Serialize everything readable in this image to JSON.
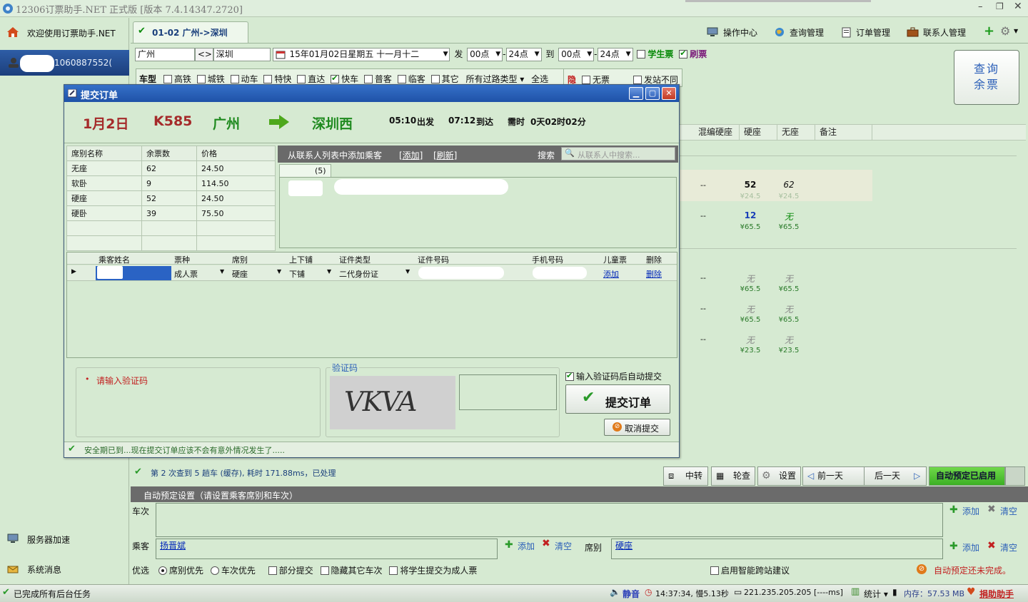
{
  "app": {
    "title": "12306订票助手.NET   正式版 [版本 7.4.14347.2720]",
    "colors": {
      "accent": "#2b5fb8",
      "green": "#0a8a0a",
      "red": "#c22020",
      "panel": "#d6ead2"
    }
  },
  "sidebar": {
    "welcome": "欢迎使用订票助手.NET",
    "account": "1060887552(",
    "items": [
      {
        "label": "服务器加速",
        "icon": "monitor-icon"
      },
      {
        "label": "系统消息",
        "icon": "message-icon"
      }
    ]
  },
  "topbar": {
    "tab_label": "01-02 广州->深圳",
    "menu": [
      {
        "label": "操作中心",
        "icon": "monitor-icon"
      },
      {
        "label": "查询管理",
        "icon": "globe-icon"
      },
      {
        "label": "订单管理",
        "icon": "document-icon"
      },
      {
        "label": "联系人管理",
        "icon": "briefcase-icon"
      }
    ]
  },
  "search": {
    "from": "广州",
    "swap": "<>",
    "to": "深圳",
    "date": "15年01月02日星期五 十一月十二",
    "depart_label": "发",
    "depart_from": "00点",
    "dash": "-",
    "depart_to": "24点",
    "arrive_label": "到",
    "arrive_from": "00点",
    "arrive_to": "24点",
    "student_label": "学生票",
    "brush_label": "刷票",
    "type_label": "车型",
    "types": [
      {
        "label": "高铁",
        "checked": false
      },
      {
        "label": "城铁",
        "checked": false
      },
      {
        "label": "动车",
        "checked": false
      },
      {
        "label": "特快",
        "checked": false
      },
      {
        "label": "直达",
        "checked": false
      },
      {
        "label": "快车",
        "checked": true
      },
      {
        "label": "普客",
        "checked": false
      },
      {
        "label": "临客",
        "checked": false
      },
      {
        "label": "其它",
        "checked": false
      }
    ],
    "passing_label": "所有过路类型",
    "select_all": "全选",
    "hide_label": "隐",
    "no_ticket": "无票",
    "diff_station": "发站不同",
    "query_button": "查询\n余票"
  },
  "results": {
    "headers": [
      "混编硬座",
      "硬座",
      "无座",
      "备注"
    ],
    "rows": [
      {
        "mixed": "--",
        "hard": "52",
        "hard_price": "¥24.5",
        "none": "62",
        "none_price": "¥24.5"
      },
      {
        "mixed": "--",
        "hard": "12",
        "hard_price": "¥65.5",
        "none": "无",
        "none_price": "¥65.5"
      },
      {
        "mixed": "--",
        "hard": "无",
        "hard_price": "¥65.5",
        "none": "无",
        "none_price": "¥65.5"
      },
      {
        "mixed": "--",
        "hard": "无",
        "hard_price": "¥65.5",
        "none": "无",
        "none_price": "¥65.5"
      },
      {
        "mixed": "--",
        "hard": "无",
        "hard_price": "¥23.5",
        "none": "无",
        "none_price": "¥23.5"
      }
    ]
  },
  "dialog": {
    "title": "提交订单",
    "date": "1月2日",
    "train": "K585",
    "from": "广州",
    "to": "深圳西",
    "depart_time": "05:10",
    "depart_label": "出发",
    "arrive_time": "07:12",
    "arrive_label": "到达",
    "duration_label": "需时",
    "duration": "0天02时02分",
    "seat_headers": [
      "席别名称",
      "余票数",
      "价格"
    ],
    "seats": [
      {
        "name": "无座",
        "count": "62",
        "price": "24.50"
      },
      {
        "name": "软卧",
        "count": "9",
        "price": "114.50"
      },
      {
        "name": "硬座",
        "count": "52",
        "price": "24.50"
      },
      {
        "name": "硬卧",
        "count": "39",
        "price": "75.50"
      }
    ],
    "contacts_title": "从联系人列表中添加乘客",
    "contacts_add": "[添加]",
    "contacts_refresh": "[刷新]",
    "search_label": "搜索",
    "search_placeholder": "从联系人中搜索...",
    "contacts_tab_count": "(5)",
    "passenger_headers": [
      "乘客姓名",
      "票种",
      "席别",
      "上下铺",
      "证件类型",
      "证件号码",
      "手机号码",
      "儿童票",
      "删除"
    ],
    "passenger": {
      "ticket_type": "成人票",
      "seat": "硬座",
      "berth": "下铺",
      "id_type": "二代身份证",
      "child": "添加",
      "delete": "删除"
    },
    "message": "请输入验证码",
    "captcha_label": "验证码",
    "captcha_text": "VKVA",
    "auto_submit_label": "输入验证码后自动提交",
    "submit_label": "提交订单",
    "cancel_label": "取消提交",
    "status": "安全期已到...现在提交订单应该不会有意外情况发生了....."
  },
  "toolbar": {
    "status": "第 2 次查到 5 趟车 (缓存), 耗时 171.88ms，已处理",
    "transfer": "中转",
    "poll": "轮查",
    "settings": "设置",
    "prev_day": "前一天",
    "next_day": "后一天",
    "auto_enabled": "自动预定已启用"
  },
  "auto": {
    "header": "自动预定设置（请设置乘客席别和车次）",
    "train_label": "车次",
    "passenger_label": "乘客",
    "passenger_value": "扬晋斌",
    "seat_label": "席别",
    "seat_value": "硬座",
    "add": "添加",
    "clear": "清空",
    "prefer_label": "优选",
    "options": [
      {
        "label": "席别优先",
        "kind": "radio",
        "checked": true
      },
      {
        "label": "车次优先",
        "kind": "radio",
        "checked": false
      },
      {
        "label": "部分提交",
        "kind": "check",
        "checked": false
      },
      {
        "label": "隐藏其它车次",
        "kind": "check",
        "checked": false
      },
      {
        "label": "将学生提交为成人票",
        "kind": "check",
        "checked": false
      }
    ],
    "smart_label": "启用智能跨站建议",
    "not_done": "自动预定还未完成。"
  },
  "statusbar": {
    "left": "已完成所有后台任务",
    "sound": "静音",
    "time": "14:37:34, 慢5.13秒",
    "ip": "221.235.205.205 [----ms]",
    "stats": "统计",
    "memory": "内存：57.53 MB",
    "donate": "捐助助手"
  }
}
